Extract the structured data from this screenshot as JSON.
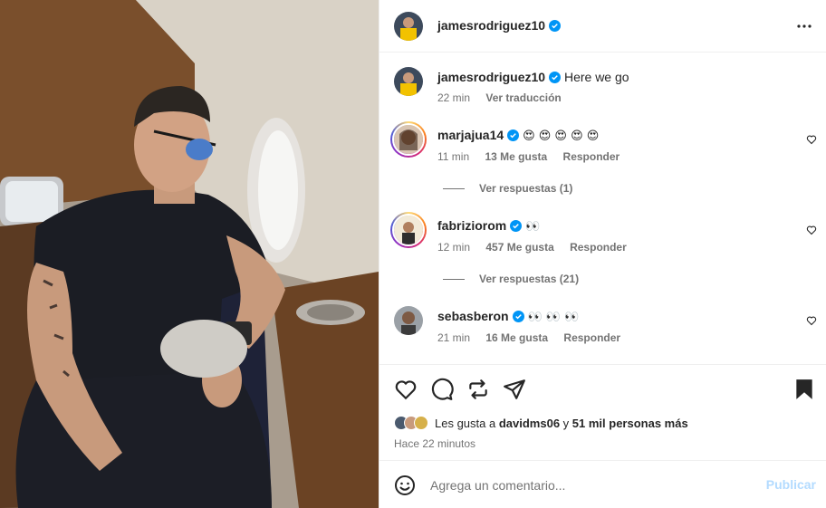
{
  "post": {
    "author": "jamesrodriguez10",
    "more_icon": "more-horizontal-icon"
  },
  "caption": {
    "username": "jamesrodriguez10",
    "text": "Here we go",
    "age": "22 min",
    "translate": "Ver traducción"
  },
  "comments": [
    {
      "username": "marjajua14",
      "text": "😍 😍 😍 😍 😍",
      "age": "11 min",
      "likes": "13 Me gusta",
      "reply": "Responder",
      "view_replies": "Ver respuestas (1)"
    },
    {
      "username": "fabriziorom",
      "text": "👀",
      "age": "12 min",
      "likes": "457 Me gusta",
      "reply": "Responder",
      "view_replies": "Ver respuestas (21)"
    },
    {
      "username": "sebasberon",
      "text": "👀 👀 👀",
      "age": "21 min",
      "likes": "16 Me gusta",
      "reply": "Responder"
    }
  ],
  "likes_line": {
    "prefix": "Les gusta a",
    "user": "davidms06",
    "middle": "y",
    "count": "51 mil personas más"
  },
  "post_time": "Hace 22 minutos",
  "comment_box": {
    "placeholder": "Agrega un comentario...",
    "publish": "Publicar"
  },
  "colors": {
    "verified": "#0095f6",
    "publish_disabled": "#b3dbff",
    "muted": "#737373"
  }
}
